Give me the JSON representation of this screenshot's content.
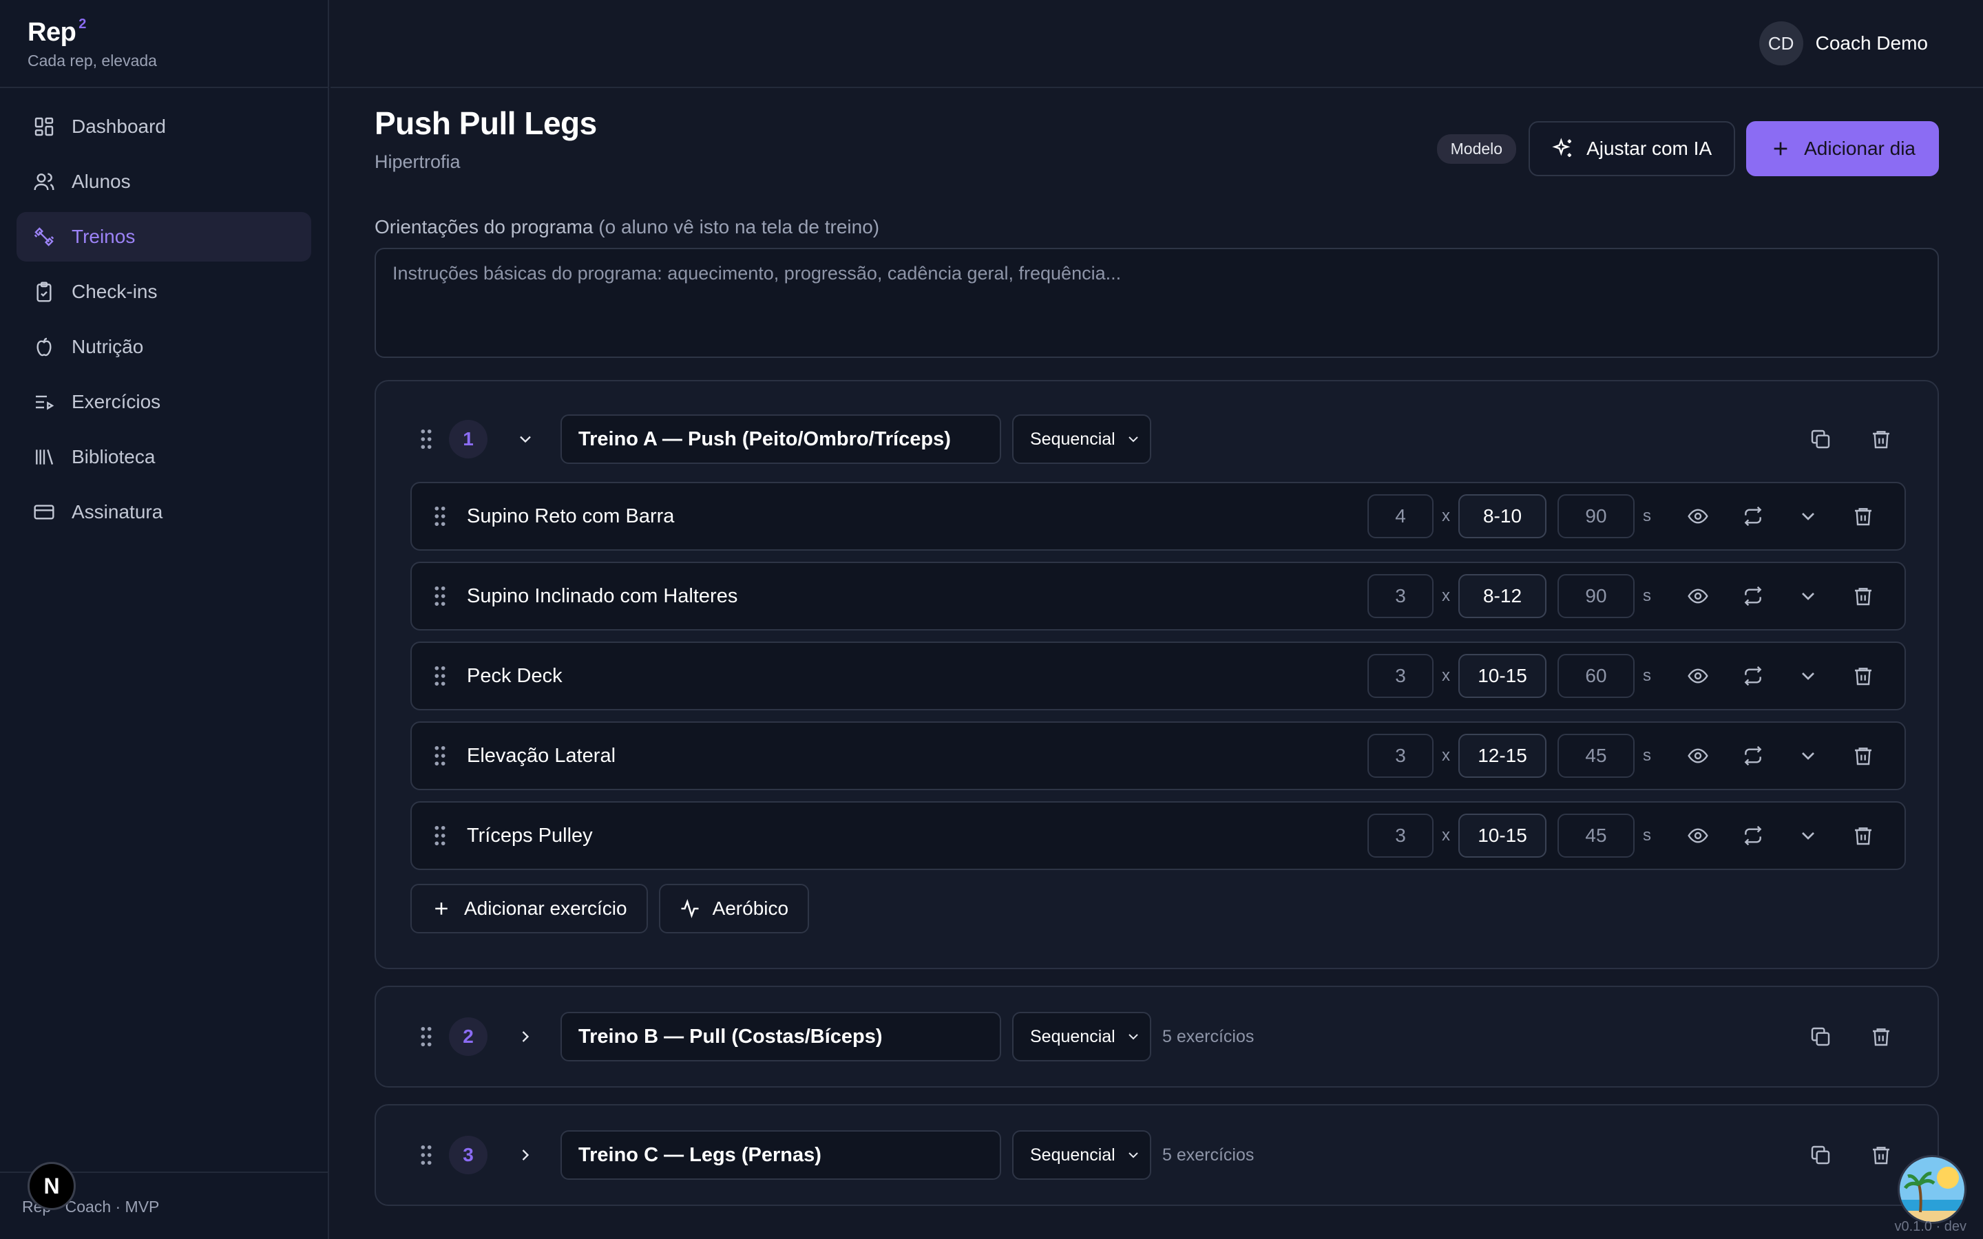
{
  "brand": {
    "name": "Rep",
    "sup": "2",
    "tagline": "Cada rep, elevada"
  },
  "nav": [
    {
      "label": "Dashboard",
      "icon": "dashboard-icon",
      "active": false
    },
    {
      "label": "Alunos",
      "icon": "users-icon",
      "active": false
    },
    {
      "label": "Treinos",
      "icon": "dumbbell-icon",
      "active": true
    },
    {
      "label": "Check-ins",
      "icon": "clipboard-check-icon",
      "active": false
    },
    {
      "label": "Nutrição",
      "icon": "apple-icon",
      "active": false
    },
    {
      "label": "Exercícios",
      "icon": "list-play-icon",
      "active": false
    },
    {
      "label": "Biblioteca",
      "icon": "library-icon",
      "active": false
    },
    {
      "label": "Assinatura",
      "icon": "credit-card-icon",
      "active": false
    }
  ],
  "sidebar_footer": "Rep · Coach · MVP",
  "next_badge": "N",
  "user": {
    "initials": "CD",
    "name": "Coach Demo"
  },
  "page": {
    "title": "Push Pull Legs",
    "subtitle": "Hipertrofia",
    "badge": "Modelo",
    "ai_button": "Ajustar com IA",
    "add_day_button": "Adicionar dia"
  },
  "orientation": {
    "label": "Orientações do programa",
    "label_hint": "(o aluno vê isto na tela de treino)",
    "placeholder": "Instruções básicas do programa: aquecimento, progressão, cadência geral, frequência..."
  },
  "days": [
    {
      "number": "1",
      "name": "Treino A — Push (Peito/Ombro/Tríceps)",
      "mode": "Sequencial",
      "expanded": true,
      "exercises": [
        {
          "name": "Supino Reto com Barra",
          "sets": "4",
          "reps": "8-10",
          "rest": "90"
        },
        {
          "name": "Supino Inclinado com Halteres",
          "sets": "3",
          "reps": "8-12",
          "rest": "90"
        },
        {
          "name": "Peck Deck",
          "sets": "3",
          "reps": "10-15",
          "rest": "60"
        },
        {
          "name": "Elevação Lateral",
          "sets": "3",
          "reps": "12-15",
          "rest": "45"
        },
        {
          "name": "Tríceps Pulley",
          "sets": "3",
          "reps": "10-15",
          "rest": "45"
        }
      ],
      "add_exercise": "Adicionar exercício",
      "add_cardio": "Aeróbico"
    },
    {
      "number": "2",
      "name": "Treino B — Pull (Costas/Bíceps)",
      "mode": "Sequencial",
      "count": "5 exercícios"
    },
    {
      "number": "3",
      "name": "Treino C — Legs (Pernas)",
      "mode": "Sequencial",
      "count": "5 exercícios"
    }
  ],
  "sets_separator": "x",
  "rest_unit": "s",
  "version": "v0.1.0 · dev",
  "colors": {
    "accent": "#8b6cf3",
    "background": "#131826",
    "sidebar": "#111726"
  }
}
